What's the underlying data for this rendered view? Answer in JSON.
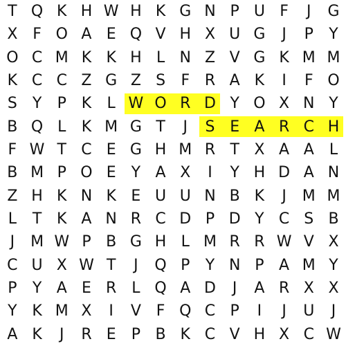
{
  "puzzle": {
    "highlight_color": "#ffff22",
    "found_words": [
      "WORD",
      "SEARCH"
    ],
    "rows": [
      [
        "T",
        "Q",
        "K",
        "H",
        "W",
        "H",
        "K",
        "G",
        "N",
        "P",
        "U",
        "F",
        "J",
        "G"
      ],
      [
        "X",
        "F",
        "O",
        "A",
        "E",
        "Q",
        "V",
        "H",
        "X",
        "U",
        "G",
        "J",
        "P",
        "Y"
      ],
      [
        "O",
        "C",
        "M",
        "K",
        "K",
        "H",
        "L",
        "N",
        "Z",
        "V",
        "G",
        "K",
        "M",
        "M"
      ],
      [
        "K",
        "C",
        "C",
        "Z",
        "G",
        "Z",
        "S",
        "F",
        "R",
        "A",
        "K",
        "I",
        "F",
        "O"
      ],
      [
        "S",
        "Y",
        "P",
        "K",
        "L",
        "W",
        "O",
        "R",
        "D",
        "Y",
        "O",
        "X",
        "N",
        "Y"
      ],
      [
        "B",
        "Q",
        "L",
        "K",
        "M",
        "G",
        "T",
        "J",
        "S",
        "E",
        "A",
        "R",
        "C",
        "H"
      ],
      [
        "F",
        "W",
        "T",
        "C",
        "E",
        "G",
        "H",
        "M",
        "R",
        "T",
        "X",
        "A",
        "A",
        "L"
      ],
      [
        "B",
        "M",
        "P",
        "O",
        "E",
        "Y",
        "A",
        "X",
        "I",
        "Y",
        "H",
        "D",
        "A",
        "N"
      ],
      [
        "Z",
        "H",
        "K",
        "N",
        "K",
        "E",
        "U",
        "U",
        "N",
        "B",
        "K",
        "J",
        "M",
        "M"
      ],
      [
        "L",
        "T",
        "K",
        "A",
        "N",
        "R",
        "C",
        "D",
        "P",
        "D",
        "Y",
        "C",
        "S",
        "B"
      ],
      [
        "J",
        "M",
        "W",
        "P",
        "B",
        "G",
        "H",
        "L",
        "M",
        "R",
        "R",
        "W",
        "V",
        "X"
      ],
      [
        "C",
        "U",
        "X",
        "W",
        "T",
        "J",
        "Q",
        "P",
        "Y",
        "N",
        "P",
        "A",
        "M",
        "Y"
      ],
      [
        "P",
        "Y",
        "A",
        "E",
        "R",
        "L",
        "Q",
        "A",
        "D",
        "J",
        "A",
        "R",
        "X",
        "X"
      ],
      [
        "Y",
        "K",
        "M",
        "X",
        "I",
        "V",
        "F",
        "Q",
        "C",
        "P",
        "I",
        "J",
        "U",
        "J"
      ],
      [
        "A",
        "K",
        "J",
        "R",
        "E",
        "P",
        "B",
        "K",
        "C",
        "V",
        "H",
        "X",
        "C",
        "W"
      ]
    ]
  }
}
